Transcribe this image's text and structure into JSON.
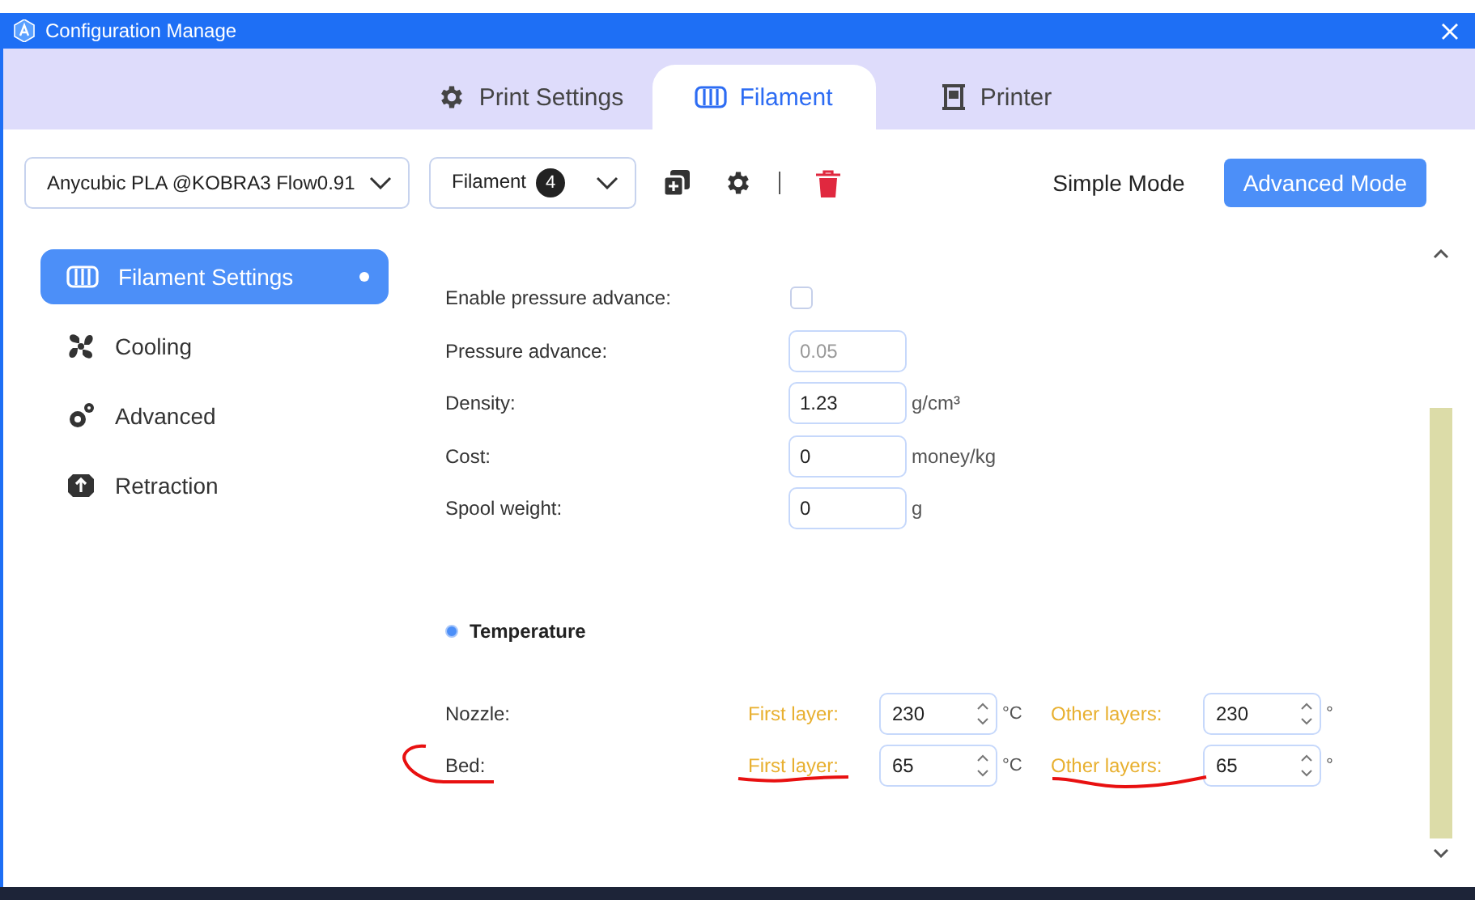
{
  "window": {
    "title": "Configuration Manage"
  },
  "tabs": [
    {
      "label": "Print Settings",
      "kind": "gear",
      "selected": false
    },
    {
      "label": "Filament",
      "kind": "spool",
      "selected": true
    },
    {
      "label": "Printer",
      "kind": "printer",
      "selected": false
    }
  ],
  "toolbar": {
    "preset": "Anycubic PLA @KOBRA3 Flow0.91",
    "filter": "Filament",
    "count": "4",
    "modes": [
      {
        "label": "Simple Mode",
        "selected": false
      },
      {
        "label": "Advanced Mode",
        "selected": true
      }
    ]
  },
  "sidebar": {
    "items": [
      {
        "label": "Filament Settings",
        "kind": "spool",
        "selected": true,
        "modified": true
      },
      {
        "label": "Cooling",
        "kind": "fan",
        "selected": false,
        "modified": false
      },
      {
        "label": "Advanced",
        "kind": "gears",
        "selected": false,
        "modified": false
      },
      {
        "label": "Retraction",
        "kind": "retract",
        "selected": false,
        "modified": false
      }
    ]
  },
  "settings": [
    {
      "kind": "checkbox",
      "label": "Enable pressure advance:",
      "checked": false
    },
    {
      "kind": "number",
      "label": "Pressure advance:",
      "value": "0.05",
      "disabled": true
    },
    {
      "kind": "number",
      "label": "Density:",
      "value": "1.23",
      "unit": "g/cm³",
      "disabled": false
    },
    {
      "kind": "number",
      "label": "Cost:",
      "value": "0",
      "unit": "money/kg",
      "disabled": false
    },
    {
      "kind": "number",
      "label": "Spool weight:",
      "value": "0",
      "unit": "g",
      "disabled": false
    }
  ],
  "temperature": {
    "title": "Temperature",
    "rows": [
      {
        "label": "Nozzle:",
        "first_label": "First layer:",
        "first_value": "230",
        "first_unit": "°C",
        "other_label": "Other layers:",
        "other_value": "230",
        "other_unit": "°",
        "marked": false
      },
      {
        "label": "Bed:",
        "first_label": "First layer:",
        "first_value": "65",
        "first_unit": "°C",
        "other_label": "Other layers:",
        "other_value": "65",
        "other_unit": "°",
        "marked": true
      }
    ]
  }
}
